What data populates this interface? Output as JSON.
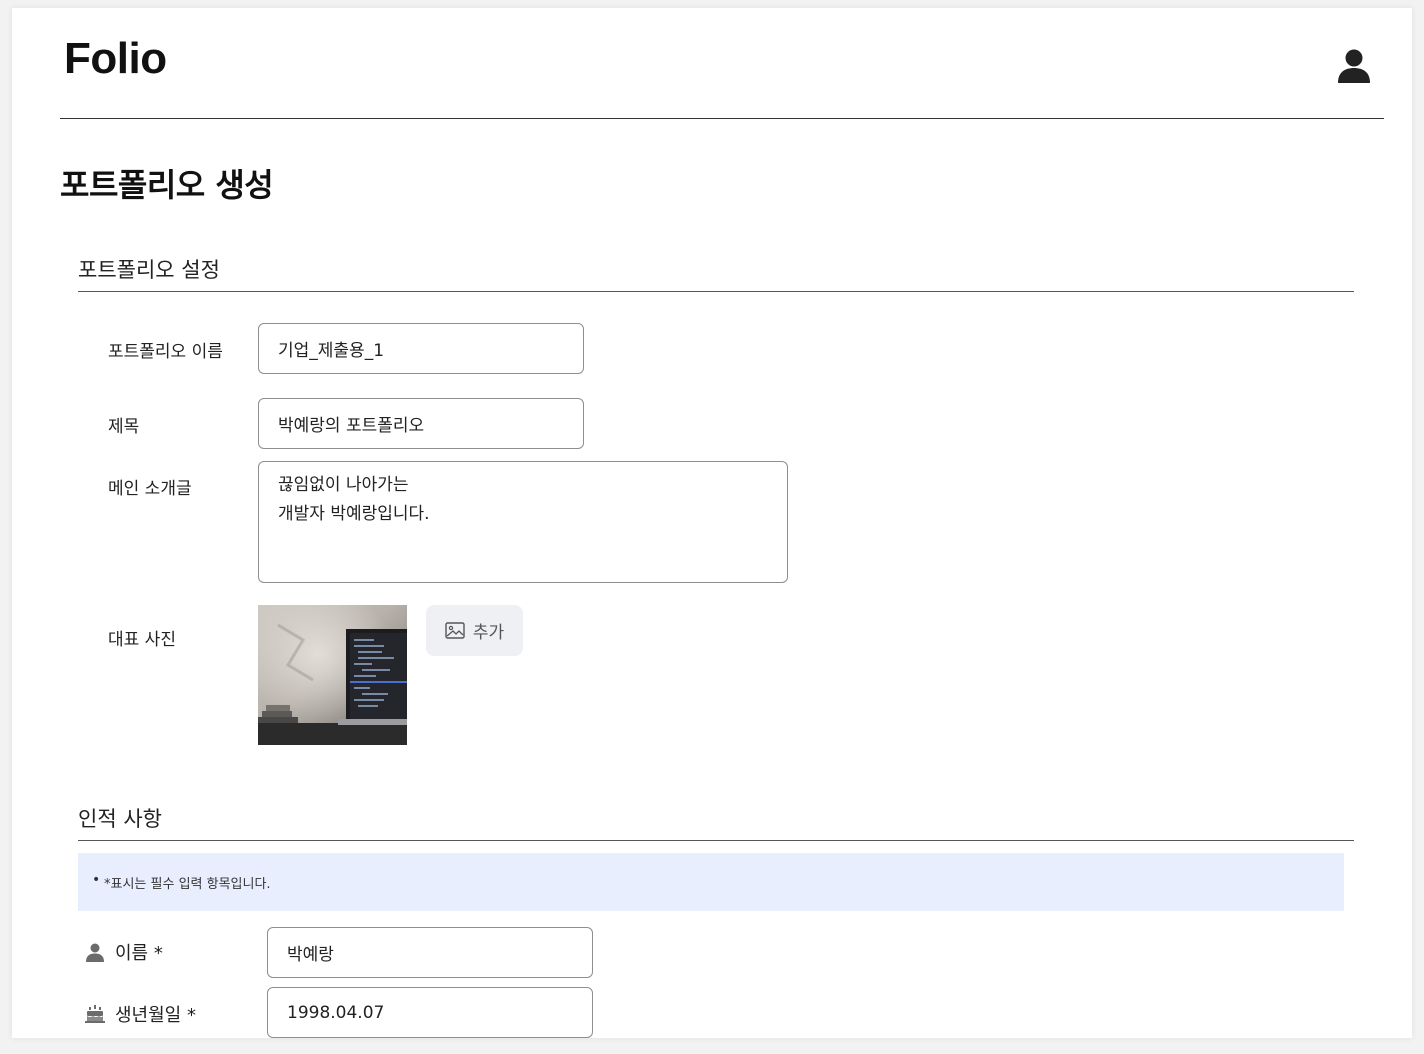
{
  "header": {
    "logo": "Folio",
    "user_icon": "user-icon"
  },
  "page": {
    "title": "포트폴리오 생성"
  },
  "portfolio_settings": {
    "section_title": "포트폴리오 설정",
    "name_label": "포트폴리오 이름",
    "name_value": "기업_제출용_1",
    "title_label": "제목",
    "title_value": "박예랑의 포트폴리오",
    "intro_label": "메인 소개글",
    "intro_value": "끊임없이 나아가는\n개발자 박예랑입니다.",
    "photo_label": "대표 사진",
    "photo_alt": "laptop on desk",
    "add_button_label": "추가",
    "add_button_icon": "image-icon"
  },
  "personal_info": {
    "section_title": "인적 사항",
    "notice": "*표시는 필수 입력 항목입니다.",
    "name_label": "이름 *",
    "name_icon": "person-icon",
    "name_value": "박예랑",
    "birth_label": "생년월일 *",
    "birth_icon": "cake-icon",
    "birth_value": "1998.04.07"
  },
  "colors": {
    "notice_bg": "#e8eefe",
    "border": "#8e8e8e",
    "add_button_bg": "#eef0f3"
  }
}
